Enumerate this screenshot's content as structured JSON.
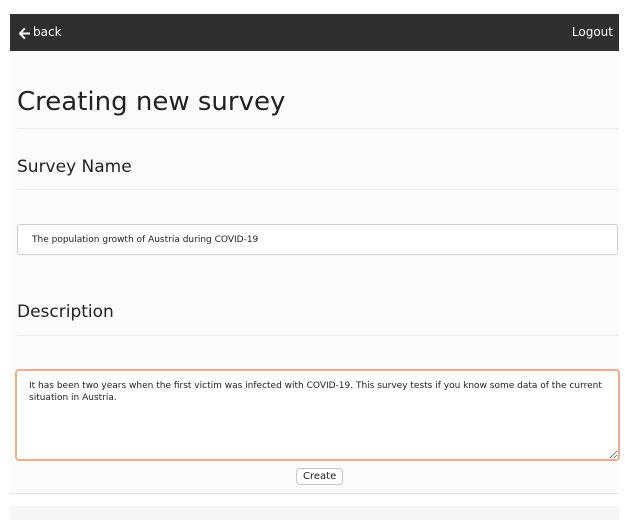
{
  "nav": {
    "back_label": "back",
    "back_icon": "arrow-left-icon",
    "logout_label": "Logout"
  },
  "page": {
    "title": "Creating new survey"
  },
  "form": {
    "name_label": "Survey Name",
    "name_value": "The population growth of Austria during COVID-19",
    "description_label": "Description",
    "description_value": "It has been two years when the first victim was infected with COVID-19. This survey tests if you know some data of the current situation in Austria.",
    "create_label": "Create"
  },
  "colors": {
    "navbar_bg": "#2f2f2f",
    "focus_border": "#e9b08f"
  }
}
